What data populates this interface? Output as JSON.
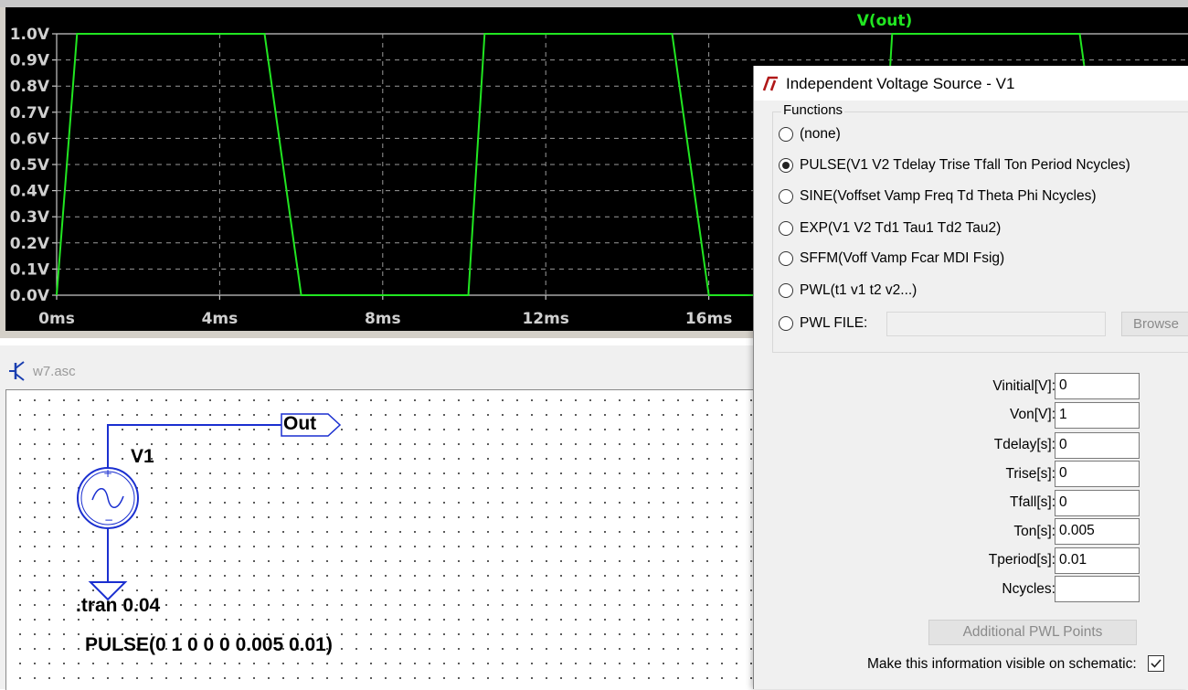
{
  "chart_data": {
    "type": "line",
    "title": "V(out)",
    "xlabel": "",
    "ylabel": "",
    "x_tick_labels": [
      "0ms",
      "4ms",
      "8ms",
      "12ms",
      "16ms"
    ],
    "x_ticks_ms": [
      0,
      4,
      8,
      12,
      16
    ],
    "y_tick_labels": [
      "0.0V",
      "0.1V",
      "0.2V",
      "0.3V",
      "0.4V",
      "0.5V",
      "0.6V",
      "0.7V",
      "0.8V",
      "0.9V",
      "1.0V"
    ],
    "y_ticks": [
      0,
      0.1,
      0.2,
      0.3,
      0.4,
      0.5,
      0.6,
      0.7,
      0.8,
      0.9,
      1.0
    ],
    "xlim_ms": [
      0,
      28.5
    ],
    "ylim": [
      0,
      1.0
    ],
    "grid": true,
    "series": [
      {
        "name": "V(out)",
        "color": "#21e621",
        "x_ms": [
          0,
          0.5,
          5.1,
          6.0,
          10.1,
          10.5,
          15.1,
          16.0,
          20.1,
          20.5,
          25.1,
          26.0
        ],
        "y": [
          0,
          1.0,
          1.0,
          0,
          0,
          1.0,
          1.0,
          0,
          0,
          1.0,
          1.0,
          0
        ]
      }
    ]
  },
  "schematic": {
    "window_title": "w7.asc",
    "label_out": "Out",
    "label_v1": "V1",
    "directive": ".tran 0.04",
    "source_value": "PULSE(0 1 0 0 0 0.005 0.01)"
  },
  "dialog": {
    "title": "Independent Voltage Source - V1",
    "group_label": "Functions",
    "functions": [
      {
        "label": "(none)",
        "checked": false
      },
      {
        "label": "PULSE(V1 V2 Tdelay Trise Tfall Ton Period Ncycles)",
        "checked": true
      },
      {
        "label": "SINE(Voffset Vamp Freq Td Theta Phi Ncycles)",
        "checked": false
      },
      {
        "label": "EXP(V1 V2 Td1 Tau1 Td2 Tau2)",
        "checked": false
      },
      {
        "label": "SFFM(Voff Vamp Fcar MDI Fsig)",
        "checked": false
      },
      {
        "label": "PWL(t1 v1 t2 v2...)",
        "checked": false
      },
      {
        "label": "PWL FILE:",
        "checked": false
      }
    ],
    "pwl_file_value": "",
    "browse_label": "Browse",
    "params": [
      {
        "label": "Vinitial[V]:",
        "value": "0"
      },
      {
        "label": "Von[V]:",
        "value": "1"
      },
      {
        "label": "Tdelay[s]:",
        "value": "0"
      },
      {
        "label": "Trise[s]:",
        "value": "0"
      },
      {
        "label": "Tfall[s]:",
        "value": "0"
      },
      {
        "label": "Ton[s]:",
        "value": "0.005"
      },
      {
        "label": "Tperiod[s]:",
        "value": "0.01"
      },
      {
        "label": "Ncycles:",
        "value": ""
      }
    ],
    "pwl_points_label": "Additional PWL Points",
    "visible_label": "Make this information visible on schematic:",
    "visible_checked": true
  }
}
